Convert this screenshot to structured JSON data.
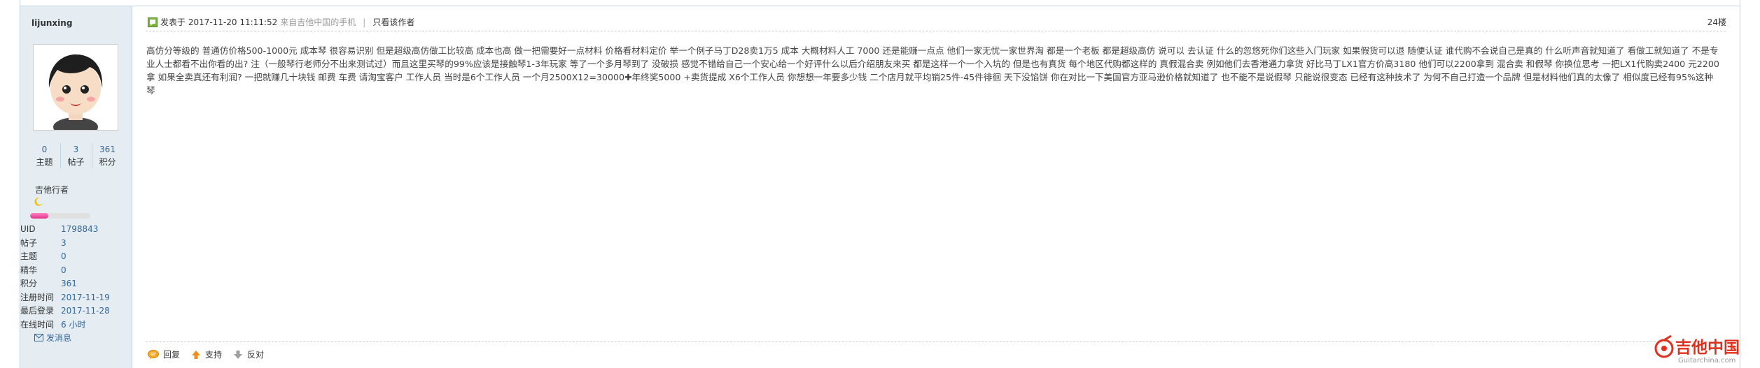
{
  "author": {
    "username": "lijunxing",
    "stats": [
      {
        "value": "0",
        "label": "主题"
      },
      {
        "value": "3",
        "label": "帖子"
      },
      {
        "value": "361",
        "label": "积分"
      }
    ],
    "group": "吉他行者",
    "level_progress": 0.3,
    "info": [
      {
        "label": "UID",
        "value": "1798843"
      },
      {
        "label": "帖子",
        "value": "3"
      },
      {
        "label": "主题",
        "value": "0"
      },
      {
        "label": "精华",
        "value": "0"
      },
      {
        "label": "积分",
        "value": "361"
      },
      {
        "label": "注册时间",
        "value": "2017-11-19"
      },
      {
        "label": "最后登录",
        "value": "2017-11-28"
      },
      {
        "label": "在线时间",
        "value": "6 小时"
      }
    ],
    "send_message": "发消息"
  },
  "post": {
    "posted_label": "发表于 2017-11-20 11:11:52",
    "source": "来自吉他中国的手机",
    "author_only": "只看该作者",
    "floor": "24楼",
    "content": "高仿分等级的 普通仿价格500-1000元 成本琴 很容易识别 但是超级高仿做工比较高 成本也高 做一把需要好一点材料 价格看材料定价 举一个例子马丁D28卖1万5 成本 大概材料人工 7000 还是能赚一点点 他们一家无忧一家世界淘 都是一个老板 都是超级高仿 说可以 去认证 什么的忽悠死你们这些入门玩家 如果假货可以退 随便认证 谁代购不会说自己是真的 什么听声音就知道了 看做工就知道了 不是专业人士都看不出你看的出? 注（一般琴行老师分不出来测试过）而且这里买琴的99%应该是接触琴1-3年玩家 等了一个多月琴到了 没破损 感觉不错给自己一个安心给一个好评什么以后介绍朋友来买 都是这样一个一个入坑的 但是也有真货 每个地区代购都这样的 真假混合卖 例如他们去香港通力拿货 好比马丁LX1官方价高3180 他们可以2200拿到 混合卖 和假琴 你换位思考 一把LX1代购卖2400 元2200拿 如果全卖真还有利润? 一把就赚几十块钱 邮费 车费 请淘宝客户 工作人员 当时是6个工作人员 一个月2500X12=30000✚年终奖5000 +卖货提成 X6个工作人员 你想想一年要多少钱 二个店月就平均销25件-45件徘徊 天下没馅饼 你在对比一下美国官方亚马逊价格就知道了 也不能不是说假琴 只能说很变态 已经有这种技术了 为何不自己打造一个品牌 但是材料他们真的太像了 相似度已经有95%这种琴"
  },
  "actions": [
    {
      "label": "回复",
      "icon": "reply-icon"
    },
    {
      "label": "支持",
      "icon": "thumbs-up-icon"
    },
    {
      "label": "反对",
      "icon": "thumbs-down-icon"
    }
  ],
  "watermark": {
    "brand": "吉他中国",
    "url": "Guitarchina.com"
  },
  "colors": {
    "sidebar_bg": "#e5edf2",
    "border": "#c2d5e3",
    "link": "#336699",
    "accent_pink": "#e0338d",
    "logo_red": "#e0301e"
  }
}
